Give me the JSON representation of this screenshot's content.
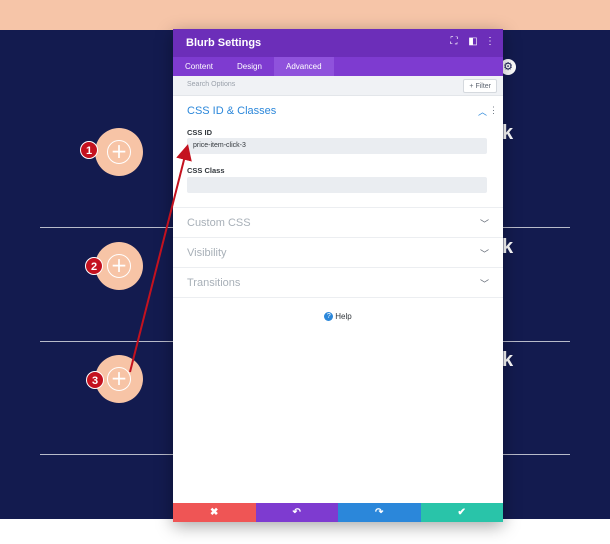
{
  "page": {
    "partial_heading_glyph": "k",
    "colors": {
      "navy": "#131b4f",
      "peach": "#f6c5a8",
      "purple": "#6c2eb9",
      "annotation_red": "#c4121f"
    }
  },
  "adders": [
    {
      "badge": "1",
      "plus": "+"
    },
    {
      "badge": "2",
      "plus": "+"
    },
    {
      "badge": "3",
      "plus": "+"
    }
  ],
  "modal": {
    "title": "Blurb Settings",
    "header_icons": [
      "expand-icon",
      "split-view-icon",
      "more-icon"
    ],
    "tabs": [
      {
        "label": "Content",
        "active": false
      },
      {
        "label": "Design",
        "active": false
      },
      {
        "label": "Advanced",
        "active": true
      }
    ],
    "search": {
      "placeholder": "Search Options",
      "filter_label": "+ Filter"
    },
    "css_section": {
      "title": "CSS ID & Classes",
      "css_id_label": "CSS ID",
      "css_id_value": "price-item-click-3",
      "css_class_label": "CSS Class",
      "css_class_value": ""
    },
    "collapsed_sections": [
      "Custom CSS",
      "Visibility",
      "Transitions"
    ],
    "help_label": "Help",
    "footer_buttons": [
      {
        "name": "discard",
        "glyph": "✖",
        "color": "#ef5555"
      },
      {
        "name": "undo",
        "glyph": "↶",
        "color": "#7e3bd0"
      },
      {
        "name": "redo",
        "glyph": "↷",
        "color": "#2b87da"
      },
      {
        "name": "save",
        "glyph": "✔",
        "color": "#29c4a9"
      }
    ]
  }
}
